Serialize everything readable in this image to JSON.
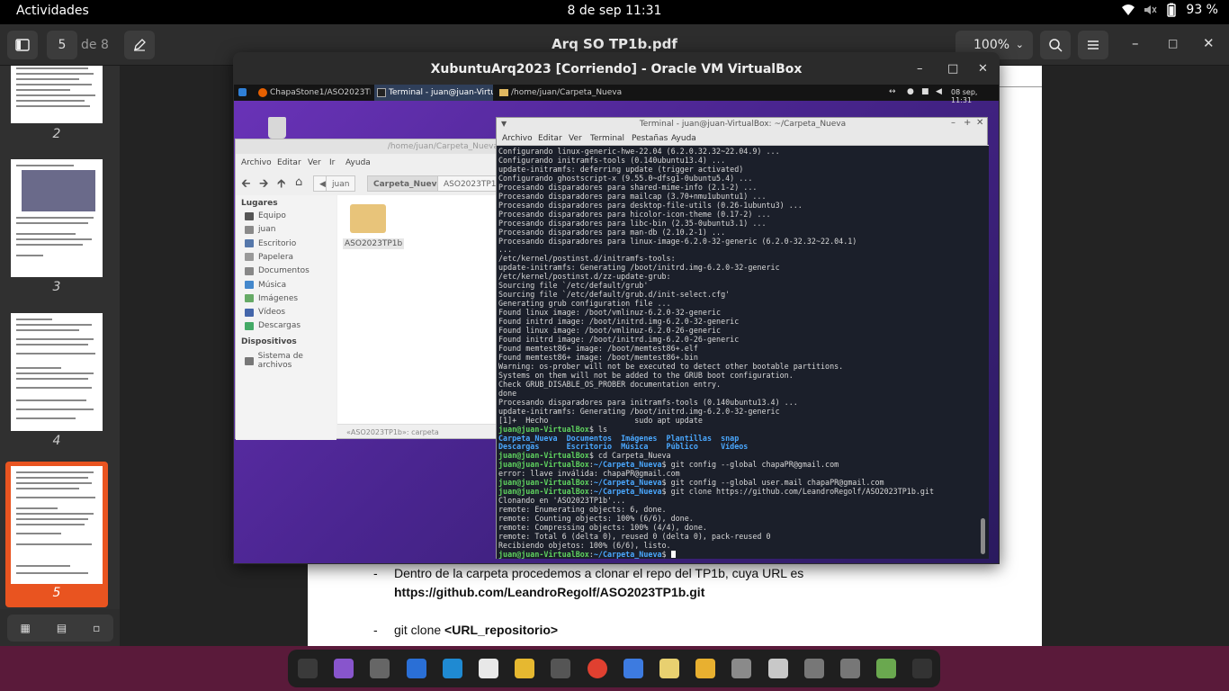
{
  "topbar": {
    "activities": "Actividades",
    "clock": "8 de sep  11:31",
    "battery": "93 %"
  },
  "viewer": {
    "page_current": "5",
    "page_total": "de 8",
    "title": "Arq SO TP1b.pdf",
    "zoom": "100%",
    "thumbnails": [
      {
        "num": "2"
      },
      {
        "num": "3"
      },
      {
        "num": "4"
      },
      {
        "num": "5"
      }
    ]
  },
  "document": {
    "bullet": "-",
    "line1": "Dentro de la carpeta procedemos a clonar el repo del TP1b, cuya URL es",
    "line1_bold": "https://github.com/LeandroRegolf/ASO2023TP1b.git",
    "line2_prefix": "git clone ",
    "line2_bold": "<URL_repositorio>"
  },
  "vbox": {
    "title": "XubuntuArq2023 [Corriendo] - Oracle VM VirtualBox",
    "guest_panel": {
      "tasks": [
        "ChapaStone1/ASO2023TP1...",
        "Terminal - juan@juan-Virtual...",
        "/home/juan/Carpeta_Nueva"
      ],
      "clock": "08 sep, 11:31"
    }
  },
  "filemanager": {
    "title": "/home/juan/Carpeta_Nueva",
    "menu": [
      "Archivo",
      "Editar",
      "Ver",
      "Ir",
      "Ayuda"
    ],
    "crumbs": [
      "juan",
      "Carpeta_Nueva",
      "ASO2023TP1b"
    ],
    "places_header": "Lugares",
    "places": [
      "Equipo",
      "juan",
      "Escritorio",
      "Papelera",
      "Documentos",
      "Música",
      "Imágenes",
      "Vídeos",
      "Descargas"
    ],
    "devices_header": "Dispositivos",
    "devices": [
      "Sistema de archivos"
    ],
    "item": "ASO2023TP1b",
    "status": "«ASO2023TP1b»: carpeta"
  },
  "terminal": {
    "title": "Terminal - juan@juan-VirtualBox: ~/Carpeta_Nueva",
    "menu": [
      "Archivo",
      "Editar",
      "Ver",
      "Terminal",
      "Pestañas",
      "Ayuda"
    ],
    "prompt_user": "juan@juan-VirtualBox",
    "lines": [
      "Configurando linux-generic-hwe-22.04 (6.2.0.32.32~22.04.9) ...",
      "Configurando initramfs-tools (0.140ubuntu13.4) ...",
      "update-initramfs: deferring update (trigger activated)",
      "Configurando ghostscript-x (9.55.0~dfsg1-0ubuntu5.4) ...",
      "Procesando disparadores para shared-mime-info (2.1-2) ...",
      "Procesando disparadores para mailcap (3.70+nmu1ubuntu1) ...",
      "Procesando disparadores para desktop-file-utils (0.26-1ubuntu3) ...",
      "Procesando disparadores para hicolor-icon-theme (0.17-2) ...",
      "Procesando disparadores para libc-bin (2.35-0ubuntu3.1) ...",
      "Procesando disparadores para man-db (2.10.2-1) ...",
      "Procesando disparadores para linux-image-6.2.0-32-generic (6.2.0-32.32~22.04.1)",
      "...",
      "/etc/kernel/postinst.d/initramfs-tools:",
      "update-initramfs: Generating /boot/initrd.img-6.2.0-32-generic",
      "/etc/kernel/postinst.d/zz-update-grub:",
      "Sourcing file `/etc/default/grub'",
      "Sourcing file `/etc/default/grub.d/init-select.cfg'",
      "Generating grub configuration file ...",
      "Found linux image: /boot/vmlinuz-6.2.0-32-generic",
      "Found initrd image: /boot/initrd.img-6.2.0-32-generic",
      "Found linux image: /boot/vmlinuz-6.2.0-26-generic",
      "Found initrd image: /boot/initrd.img-6.2.0-26-generic",
      "Found memtest86+ image: /boot/memtest86+.elf",
      "Found memtest86+ image: /boot/memtest86+.bin",
      "Warning: os-prober will not be executed to detect other bootable partitions.",
      "Systems on them will not be added to the GRUB boot configuration.",
      "Check GRUB_DISABLE_OS_PROBER documentation entry.",
      "done",
      "Procesando disparadores para initramfs-tools (0.140ubuntu13.4) ...",
      "update-initramfs: Generating /boot/initrd.img-6.2.0-32-generic",
      "[1]+  Hecho                   sudo apt update"
    ],
    "cmd1": "$ ls",
    "ls_row1": "Carpeta_Nueva  Documentos  Imágenes  Plantillas  snap",
    "ls_row2": "Descargas      Escritorio  Música    Público     Vídeos",
    "cmd2": "$ cd Carpeta_Nueva",
    "path": "~/Carpeta_Nueva",
    "cmd3": "$ git config --global chapaPR@gmail.com",
    "err": "error: llave inválida: chapaPR@gmail.com",
    "cmd4": "$ git config --global user.mail chapaPR@gmail.com",
    "cmd5": "$ git clone https://github.com/LeandroRegolf/ASO2023TP1b.git",
    "clone_lines": [
      "Clonando en 'ASO2023TP1b'...",
      "remote: Enumerating objects: 6, done.",
      "remote: Counting objects: 100% (6/6), done.",
      "remote: Compressing objects: 100% (4/4), done.",
      "remote: Total 6 (delta 0), reused 0 (delta 0), pack-reused 0",
      "Recibiendo objetos: 100% (6/6), listo."
    ],
    "cmd6": "$ "
  },
  "dock": {
    "icons": [
      "terminal-icon",
      "software-icon",
      "vm-icon",
      "writer-icon",
      "vscode-icon",
      "word-icon",
      "game-icon",
      "tool-icon",
      "chrome-icon",
      "docs-icon",
      "archive-icon",
      "paint-icon",
      "files-icon",
      "print-icon",
      "ssd-icon",
      "ssd2-icon",
      "trash-icon",
      "apps-grid-icon"
    ],
    "colors": [
      "#3a3a3a",
      "#8855cc",
      "#666666",
      "#2a6fd6",
      "#1f8ad2",
      "#e8e8e8",
      "#e6b830",
      "#555555",
      "#e04030",
      "#3d7be0",
      "#e8d070",
      "#e8b030",
      "#8a8a8a",
      "#c8c8c8",
      "#777777",
      "#777777",
      "#6aa84f",
      "#333333"
    ]
  }
}
